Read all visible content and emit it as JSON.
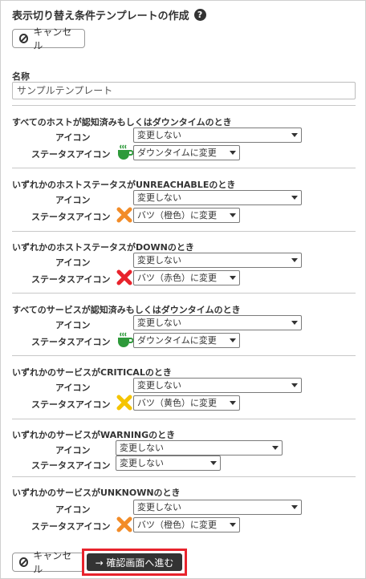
{
  "page": {
    "title": "表示切り替え条件テンプレートの作成",
    "help_icon": "?"
  },
  "buttons": {
    "cancel": "キャンセル",
    "confirm": "→ 確認画面へ進む"
  },
  "form": {
    "name_label": "名称",
    "name_value": "サンプルテンプレート"
  },
  "labels": {
    "icon": "アイコン",
    "status_icon": "ステータスアイコン"
  },
  "sections": [
    {
      "title": "すべてのホストが認知済みもしくはダウンタイムのとき",
      "icon_select": "変更しない",
      "status_select": "ダウンタイムに変更",
      "status_icon": "coffee-cup-icon"
    },
    {
      "title": "いずれかのホストステータスがUNREACHABLEのとき",
      "icon_select": "変更しない",
      "status_select": "バツ（橙色）に変更",
      "status_icon": "orange-x-icon"
    },
    {
      "title": "いずれかのホストステータスがDOWNのとき",
      "icon_select": "変更しない",
      "status_select": "バツ（赤色）に変更",
      "status_icon": "red-x-icon"
    },
    {
      "title": "すべてのサービスが認知済みもしくはダウンタイムのとき",
      "icon_select": "変更しない",
      "status_select": "ダウンタイムに変更",
      "status_icon": "coffee-cup-icon"
    },
    {
      "title": "いずれかのサービスがCRITICALのとき",
      "icon_select": "変更しない",
      "status_select": "バツ（黄色）に変更",
      "status_icon": "yellow-x-icon"
    },
    {
      "title": "いずれかのサービスがWARNINGのとき",
      "icon_select": "変更しない",
      "status_select": "変更しない",
      "status_icon": ""
    },
    {
      "title": "いずれかのサービスがUNKNOWNのとき",
      "icon_select": "変更しない",
      "status_select": "バツ（橙色）に変更",
      "status_icon": "orange-x-icon"
    }
  ],
  "colors": {
    "coffee": "#2e9a3b",
    "orange_x": "#f28c28",
    "red_x": "#e8232c",
    "yellow_x": "#f5c400",
    "highlight": "#e8232c"
  }
}
